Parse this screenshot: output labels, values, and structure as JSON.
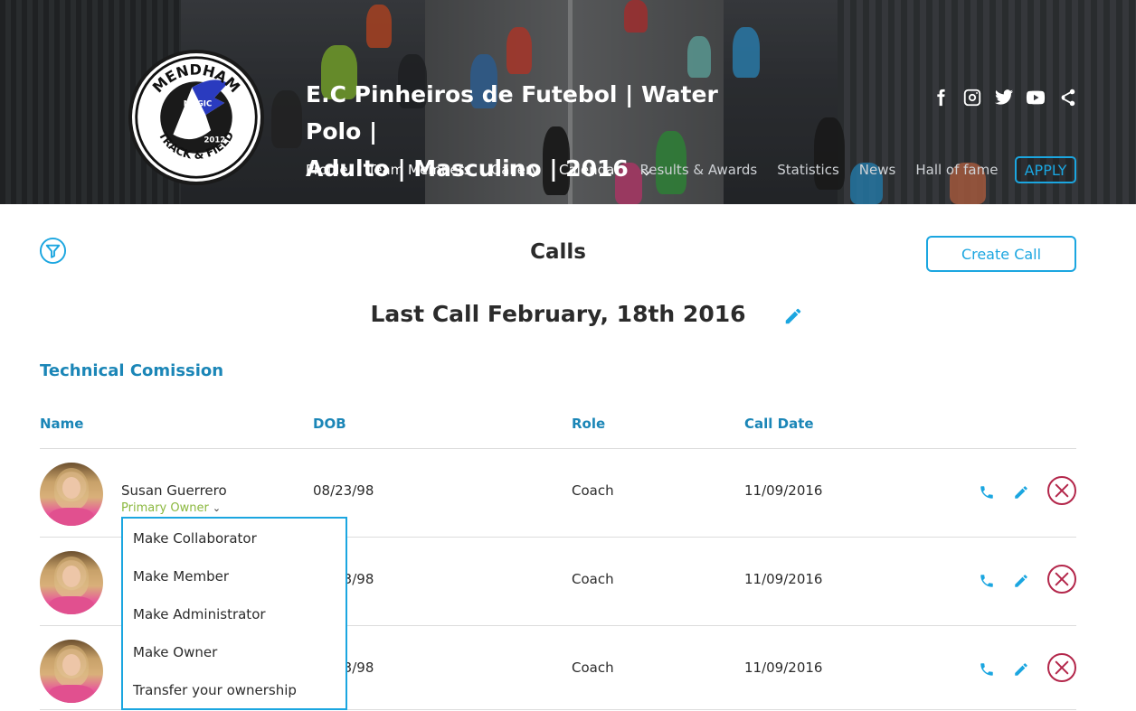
{
  "header": {
    "title_line1": "E.C Pinheiros de Futebol | Water Polo |",
    "title_line2": "Adulto | Masculino | 2016",
    "logo_text_top": "MENDHAM",
    "logo_text_mid": "MAGIC",
    "logo_text_year": "2012",
    "logo_text_bottom": "TRACK & FIELD",
    "social_icons": [
      "facebook-icon",
      "instagram-icon",
      "twitter-icon",
      "youtube-icon",
      "share-icon"
    ],
    "nav": [
      "Profile",
      "Team Members",
      "Gallery",
      "Calendar",
      "Results & Awards",
      "Statistics",
      "News",
      "Hall of fame"
    ],
    "apply_label": "APPLY"
  },
  "main": {
    "page_title": "Calls",
    "create_call_label": "Create Call",
    "last_call_title": "Last Call February, 18th 2016",
    "section_title": "Technical Comission",
    "columns": [
      "Name",
      "DOB",
      "Role",
      "Call Date"
    ],
    "rows": [
      {
        "name": "Susan Guerrero",
        "subrole": "Primary Owner",
        "dob": "08/23/98",
        "role": "Coach",
        "call_date": "11/09/2016"
      },
      {
        "name": "",
        "subrole": "",
        "dob": "08/23/98",
        "role": "Coach",
        "call_date": "11/09/2016"
      },
      {
        "name": "",
        "subrole": "",
        "dob": "08/23/98",
        "role": "Coach",
        "call_date": "11/09/2016"
      }
    ]
  },
  "dropdown": {
    "items": [
      "Make Collaborator",
      "Make Member",
      "Make Administrator",
      "Make Owner",
      "Transfer your ownership"
    ]
  },
  "colors": {
    "accent": "#1ba6e0",
    "heading_blue": "#1b86b7",
    "owner_green": "#8bb83f",
    "delete_red": "#b3264a"
  }
}
